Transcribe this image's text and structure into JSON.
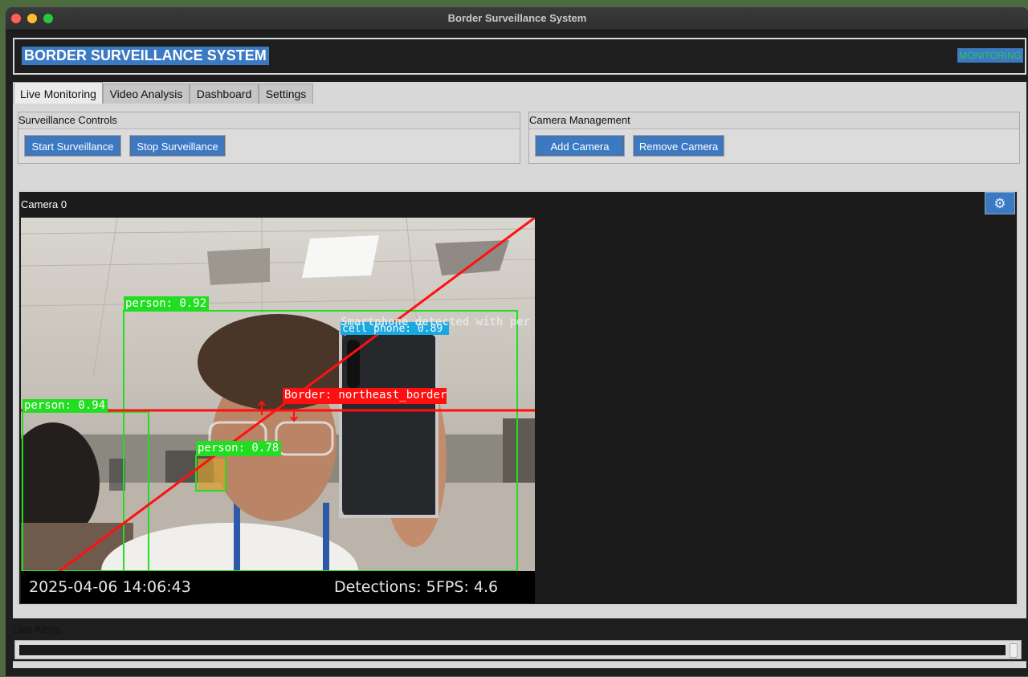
{
  "window": {
    "title": "Border Surveillance System"
  },
  "header": {
    "title": "BORDER SURVEILLANCE SYSTEM",
    "status": "MONITORING",
    "status_color": "#2ec35a"
  },
  "tabs": [
    {
      "label": "Live Monitoring",
      "active": true
    },
    {
      "label": "Video Analysis",
      "active": false
    },
    {
      "label": "Dashboard",
      "active": false
    },
    {
      "label": "Settings",
      "active": false
    }
  ],
  "surveillance_controls": {
    "title": "Surveillance Controls",
    "start_label": "Start Surveillance",
    "stop_label": "Stop Surveillance"
  },
  "camera_management": {
    "title": "Camera Management",
    "add_label": "Add Camera",
    "remove_label": "Remove Camera"
  },
  "camera": {
    "label": "Camera 0",
    "settings_icon": "gear-icon",
    "overlays": {
      "person_1": "person: 0.92",
      "person_2": "person: 0.94",
      "person_3": "person: 0.78",
      "phone": "cell phone: 0.89",
      "warning": "Smartphone detected with per",
      "border": "Border: northeast_border"
    },
    "timestamp": "2025-04-06 14:06:43",
    "detections": "Detections: 5",
    "fps": "FPS: 4.6"
  },
  "alerts": {
    "title": "Live Alerts"
  },
  "colors": {
    "accent": "#3b79c3",
    "detection_green": "#22dd22",
    "border_red": "#ff1010"
  }
}
